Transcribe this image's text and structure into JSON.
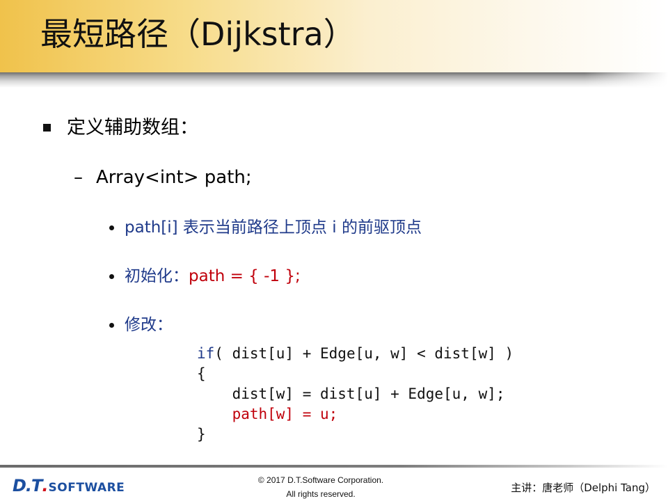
{
  "slide": {
    "title": "最短路径（Dijkstra）"
  },
  "bullets": {
    "level1": "定义辅助数组：",
    "level2_dash": "–",
    "level2": "Array<int> path;",
    "item1": "path[i] 表示当前路径上顶点 i 的前驱顶点",
    "item2_prefix": "初始化：",
    "item2_code": "path = { -1 };",
    "item3": "修改："
  },
  "code": {
    "keyword": "if",
    "line1_rest": "( dist[u] + Edge[u, w] < dist[w] )",
    "line2": "{",
    "line3": "    dist[w] = dist[u] + Edge[u, w];",
    "line4": "    path[w] = u;",
    "line5": "}"
  },
  "footer": {
    "logo_dt": "D.T",
    "logo_dot": ".",
    "logo_software": "SOFTWARE",
    "copyright_line1": "© 2017 D.T.Software Corporation.",
    "copyright_line2": "All rights reserved.",
    "lecturer": "主讲：唐老师（Delphi Tang）"
  },
  "colors": {
    "title_bar_accent": "#f0c24b",
    "text_blue": "#1f3a8a",
    "text_red": "#c0000b",
    "logo_blue": "#1c4fa0",
    "logo_red": "#d2121b"
  }
}
